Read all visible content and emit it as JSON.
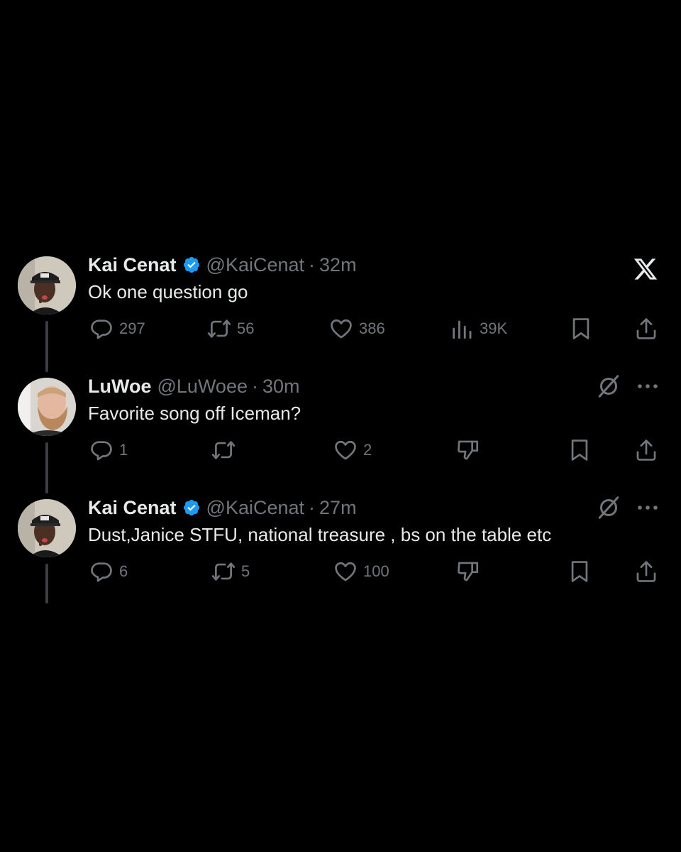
{
  "tweets": [
    {
      "name": "Kai Cenat",
      "verified": true,
      "handle": "@KaiCenat",
      "time": "32m",
      "text": "Ok one question go",
      "replies": "297",
      "reposts": "56",
      "likes": "386",
      "views": "39K",
      "avatar": "man-cap-avatar"
    },
    {
      "name": "LuWoe",
      "verified": false,
      "handle": "@LuWoee",
      "time": "30m",
      "text": "Favorite song off Iceman?",
      "replies": "1",
      "reposts": "",
      "likes": "2",
      "avatar": "bearded-man-avatar"
    },
    {
      "name": "Kai Cenat",
      "verified": true,
      "handle": "@KaiCenat",
      "time": "27m",
      "text": "Dust,Janice STFU, national treasure , bs on the table etc",
      "replies": "6",
      "reposts": "5",
      "likes": "100",
      "avatar": "man-cap-avatar"
    }
  ],
  "sep": "·",
  "colors": {
    "background": "#000000",
    "text": "#e7e9ea",
    "muted": "#71767b",
    "verified": "#1d9bf0"
  },
  "icons": [
    "x-logo-icon",
    "reply-icon",
    "repost-icon",
    "like-icon",
    "views-icon",
    "dislike-icon",
    "bookmark-icon",
    "share-icon",
    "grok-icon",
    "more-icon",
    "verified-badge-icon"
  ]
}
